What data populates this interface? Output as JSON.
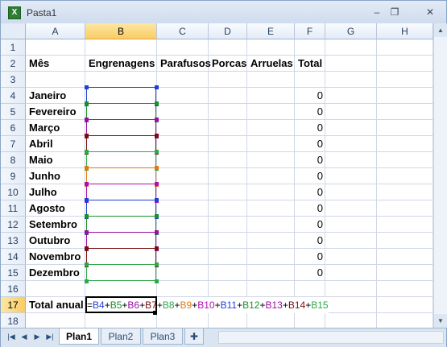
{
  "window": {
    "title": "Pasta1",
    "app_icon": "excel-icon"
  },
  "columns": [
    "A",
    "B",
    "C",
    "D",
    "E",
    "F",
    "G",
    "H"
  ],
  "selected_column": "B",
  "rows": [
    "1",
    "2",
    "3",
    "4",
    "5",
    "6",
    "7",
    "8",
    "9",
    "10",
    "11",
    "12",
    "13",
    "14",
    "15",
    "16",
    "17",
    "18"
  ],
  "selected_row": "17",
  "headers": {
    "A": "Mês",
    "B": "Engrenagens",
    "C": "Parafusos",
    "D": "Porcas",
    "E": "Arruelas",
    "F": "Total"
  },
  "months": [
    "Janeiro",
    "Fevereiro",
    "Março",
    "Abril",
    "Maio",
    "Junho",
    "Julho",
    "Agosto",
    "Setembro",
    "Outubro",
    "Novembro",
    "Dezembro"
  ],
  "totals": [
    "0",
    "0",
    "0",
    "0",
    "0",
    "0",
    "0",
    "0",
    "0",
    "0",
    "0",
    "0"
  ],
  "total_label": "Total anual",
  "formula": {
    "prefix": "=",
    "parts": [
      {
        "ref": "B4",
        "color": "#1f3fd6"
      },
      {
        "ref": "B5",
        "color": "#1b8f2c"
      },
      {
        "ref": "B6",
        "color": "#9a0fa3"
      },
      {
        "ref": "B7",
        "color": "#7a0e0e"
      },
      {
        "ref": "B8",
        "color": "#2ea84a"
      },
      {
        "ref": "B9",
        "color": "#e07a10"
      },
      {
        "ref": "B10",
        "color": "#b00fb0"
      },
      {
        "ref": "B11",
        "color": "#1f3fd6"
      },
      {
        "ref": "B12",
        "color": "#1b8f2c"
      },
      {
        "ref": "B13",
        "color": "#9a0fa3"
      },
      {
        "ref": "B14",
        "color": "#7a0e0e"
      },
      {
        "ref": "B15",
        "color": "#2ea84a"
      }
    ]
  },
  "sheets": [
    "Plan1",
    "Plan2",
    "Plan3"
  ],
  "active_sheet": "Plan1",
  "new_sheet_icon": "insert-sheet-icon"
}
